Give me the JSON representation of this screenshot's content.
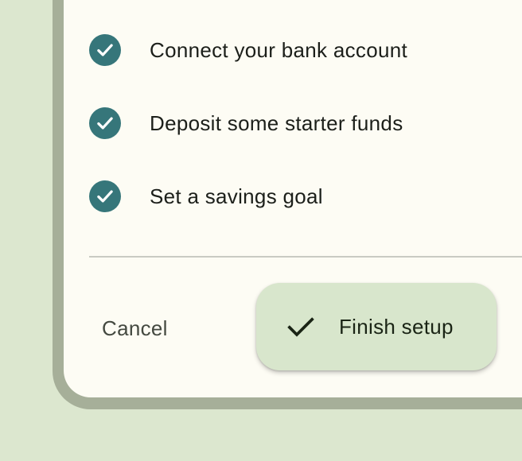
{
  "steps": [
    {
      "label": "Connect your bank account",
      "icon": "check-circle-icon",
      "completed": true
    },
    {
      "label": "Deposit some starter funds",
      "icon": "check-circle-icon",
      "completed": true
    },
    {
      "label": "Set a savings goal",
      "icon": "check-circle-icon",
      "completed": true
    }
  ],
  "actions": {
    "cancel_label": "Cancel",
    "finish_label": "Finish setup",
    "finish_icon": "check-icon"
  },
  "colors": {
    "background": "#dce7cf",
    "card": "#fdfcf4",
    "card_border": "#a6af99",
    "check_accent": "#36767a",
    "primary_button": "#d8e6cc"
  }
}
